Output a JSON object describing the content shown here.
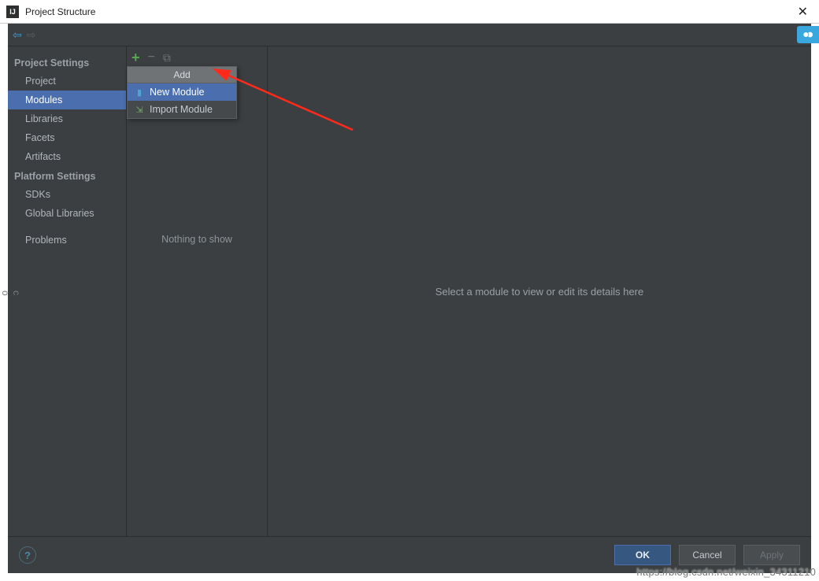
{
  "window": {
    "title": "Project Structure"
  },
  "sidebar": {
    "section1": "Project Settings",
    "items1": [
      "Project",
      "Modules",
      "Libraries",
      "Facets",
      "Artifacts"
    ],
    "section2": "Platform Settings",
    "items2": [
      "SDKs",
      "Global Libraries"
    ],
    "problems": "Problems"
  },
  "middle": {
    "empty_text": "Nothing to show"
  },
  "popup": {
    "title": "Add",
    "new_module": "New Module",
    "import_module": "Import Module"
  },
  "detail": {
    "message": "Select a module to view or edit its details here"
  },
  "footer": {
    "ok": "OK",
    "cancel": "Cancel",
    "apply": "Apply"
  },
  "watermark": "https://blog.csdn.net/weixin_34311210"
}
